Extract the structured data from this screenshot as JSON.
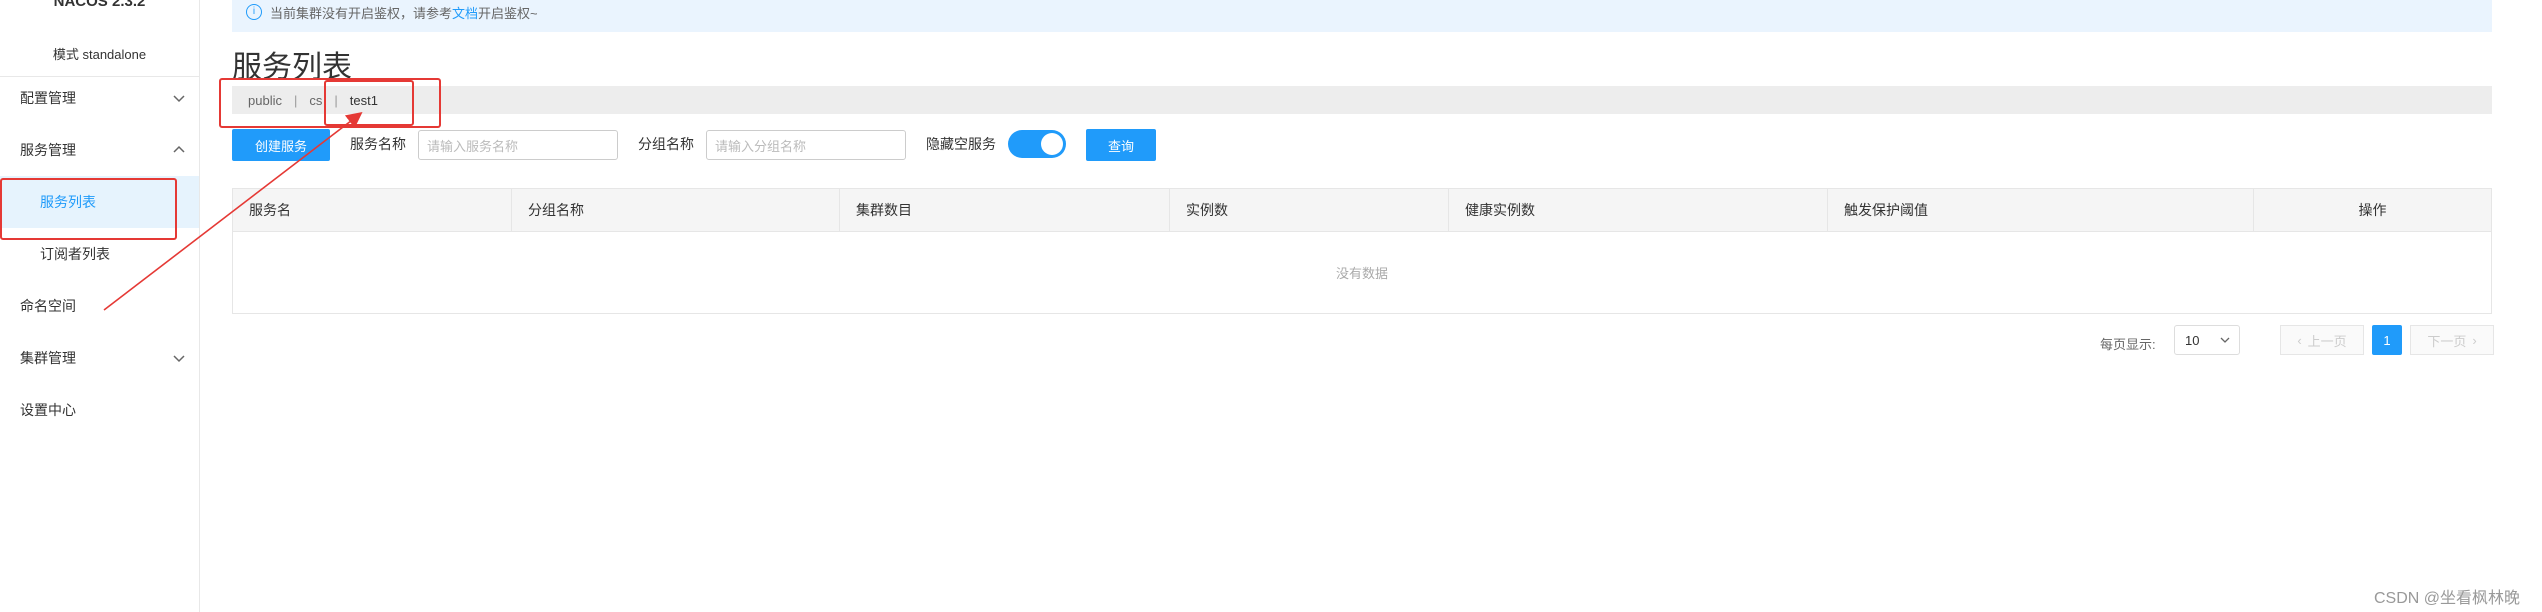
{
  "sidebar": {
    "brand": "NACOS 2.3.2",
    "mode": "模式 standalone",
    "items": [
      {
        "label": "配置管理"
      },
      {
        "label": "服务管理"
      },
      {
        "label": "服务列表"
      },
      {
        "label": "订阅者列表"
      },
      {
        "label": "命名空间"
      },
      {
        "label": "集群管理"
      },
      {
        "label": "设置中心"
      }
    ]
  },
  "notice": {
    "text_before": "当前集群没有开启鉴权，请参考",
    "link": "文档",
    "text_after": "开启鉴权~"
  },
  "page": {
    "title": "服务列表"
  },
  "namespaces": [
    "public",
    "cs",
    "test1"
  ],
  "toolbar": {
    "create_button": "创建服务",
    "service_name_label": "服务名称",
    "service_name_placeholder": "请输入服务名称",
    "group_name_label": "分组名称",
    "group_name_placeholder": "请输入分组名称",
    "hide_empty_label": "隐藏空服务",
    "query_button": "查询"
  },
  "table": {
    "columns": [
      "服务名",
      "分组名称",
      "集群数目",
      "实例数",
      "健康实例数",
      "触发保护阈值",
      "操作"
    ],
    "empty_text": "没有数据"
  },
  "pagination": {
    "per_page_label": "每页显示:",
    "page_size": "10",
    "prev": "上一页",
    "current_page": "1",
    "next": "下一页"
  },
  "watermark": "CSDN @坐看枫林晚",
  "colors": {
    "accent": "#209bfa",
    "annotation": "#e53935"
  }
}
